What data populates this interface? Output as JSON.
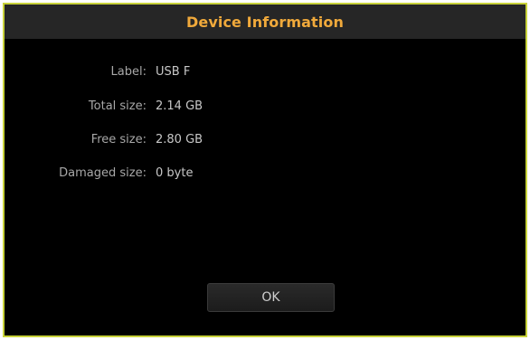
{
  "dialog": {
    "title": "Device Information",
    "fields": [
      {
        "label": "Label:",
        "value": "USB F"
      },
      {
        "label": "Total size:",
        "value": "2.14 GB"
      },
      {
        "label": "Free size:",
        "value": "2.80 GB"
      },
      {
        "label": "Damaged size:",
        "value": "0 byte"
      }
    ],
    "ok_label": "OK"
  },
  "colors": {
    "title": "#f0a93b",
    "border": "#c8d23a",
    "background": "#000000",
    "titlebar": "#262626"
  }
}
